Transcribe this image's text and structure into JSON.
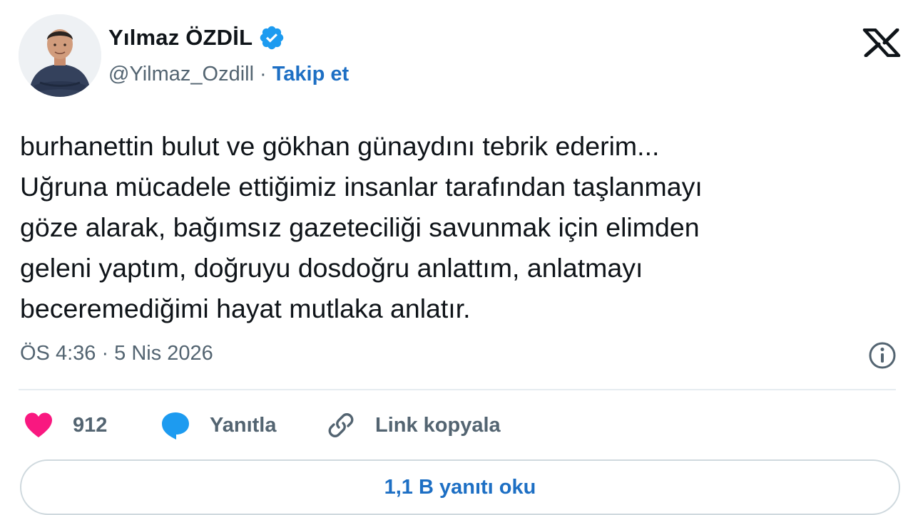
{
  "author": {
    "name": "Yılmaz ÖZDİL",
    "handle": "@Yilmaz_Ozdill",
    "separator": "·",
    "follow_label": "Takip et"
  },
  "tweet": {
    "lines": [
      "burhanettin bulut ve gökhan günaydını tebrik ederim...",
      "Uğruna mücadele ettiğimiz insanlar tarafından taşlanmayı",
      "göze alarak, bağımsız gazeteciliği savunmak için elimden",
      "geleni yaptım, doğruyu dosdoğru anlattım, anlatmayı",
      "beceremediğimi hayat mutlaka anlatır."
    ],
    "timestamp": "ÖS 4:36 · 5 Nis 2026"
  },
  "actions": {
    "like_count": "912",
    "reply_label": "Yanıtla",
    "copy_link_label": "Link kopyala"
  },
  "read_replies_label": "1,1 B yanıtı oku",
  "icons": {
    "verified": "verified-badge-icon",
    "logo": "x-logo-icon",
    "info": "info-icon",
    "like": "heart-icon",
    "reply": "speech-bubble-icon",
    "link": "link-icon"
  },
  "colors": {
    "accent": "#1d6fc4",
    "verified": "#1d9bf0",
    "like": "#f91880",
    "text": "#0f1419",
    "muted": "#536471",
    "border": "#cfd9de"
  }
}
